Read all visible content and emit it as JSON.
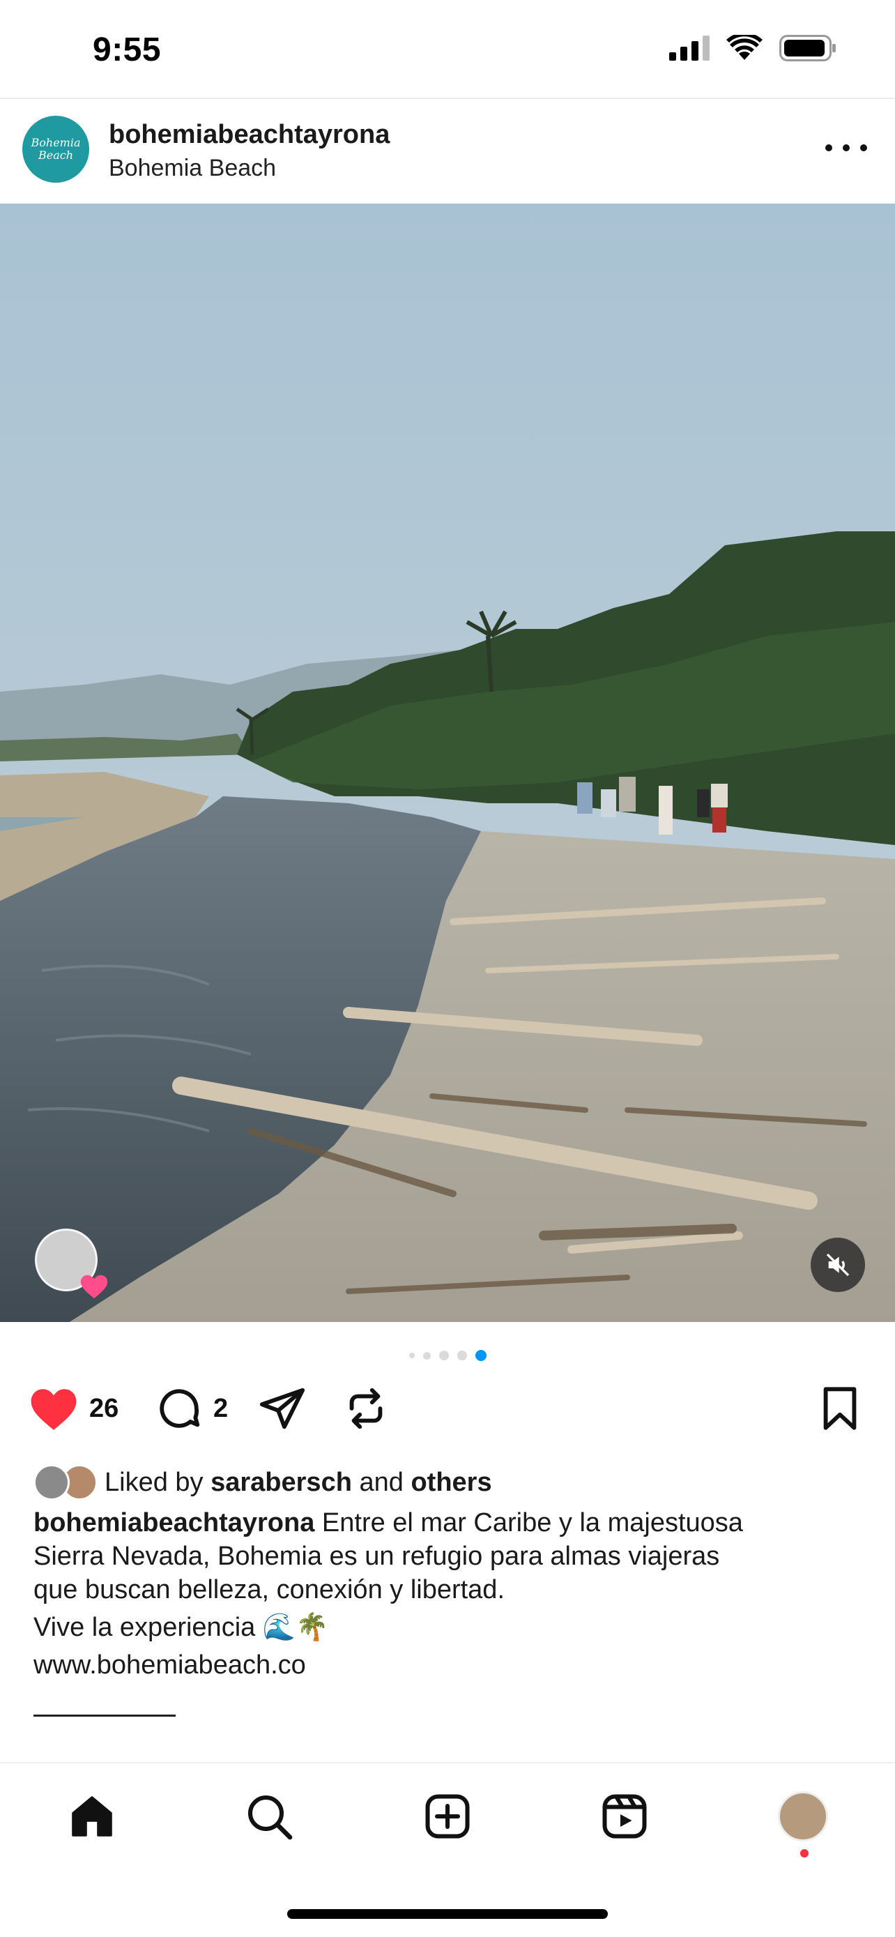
{
  "status_bar": {
    "time": "9:55"
  },
  "post": {
    "username": "bohemiabeachtayrona",
    "location": "Bohemia Beach",
    "avatar_text": [
      "Bohemia",
      "Beach"
    ],
    "carousel": {
      "count": 5,
      "active_index": 4
    },
    "likes_count": "26",
    "comments_count": "2",
    "liked_by": {
      "prefix": "Liked by",
      "user": "sarabersch",
      "joiner": "and",
      "suffix": "others"
    },
    "caption": {
      "username": "bohemiabeachtayrona",
      "text_line1": "Entre el mar Caribe y la majestuosa",
      "line2": "Sierra Nevada, Bohemia es un refugio para almas viajeras",
      "line3": "que buscan belleza, conexión y libertad.",
      "line4": "Vive la experiencia 🌊🌴",
      "line5": "www.bohemiabeach.co"
    }
  },
  "icons": {
    "like": "heart-filled-icon",
    "comment": "comment-icon",
    "share": "paper-plane-icon",
    "repost": "repost-icon",
    "save": "bookmark-icon",
    "mute": "speaker-muted-icon"
  },
  "colors": {
    "like_red": "#ff3040",
    "accent_blue": "#0095f6",
    "brand_teal": "#1f9aa0"
  },
  "tab_bar": [
    "home",
    "search",
    "create",
    "reels",
    "profile"
  ]
}
